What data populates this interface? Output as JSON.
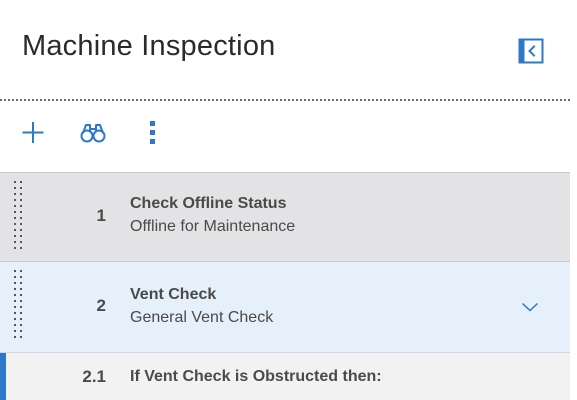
{
  "header": {
    "title": "Machine Inspection",
    "collapse_icon": "collapse-panel-left-icon",
    "accent_color": "#2f78c8"
  },
  "toolbar": {
    "add_icon": "plus-icon",
    "find_icon": "binoculars-icon",
    "more_icon": "more-vertical-icon"
  },
  "steps": [
    {
      "number": "1",
      "title": "Check Offline Status",
      "subtitle": "Offline for Maintenance",
      "state": "highlighted"
    },
    {
      "number": "2",
      "title": "Vent Check",
      "subtitle": "General Vent Check",
      "state": "selected",
      "expand_icon": "chevron-down-icon"
    },
    {
      "number": "2.1",
      "title": "If Vent Check is Obstructed then:",
      "state": "active"
    }
  ]
}
